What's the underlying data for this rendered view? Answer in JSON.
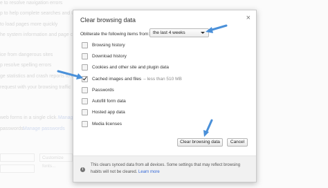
{
  "background": {
    "lines": [
      {
        "text": "e to resolve navigation errors",
        "link": false
      },
      {
        "text": "p to help complete searches and URLs",
        "link": false
      },
      {
        "text": "to load pages more quickly",
        "link": false
      },
      {
        "text": "he system information and page content",
        "link": false
      },
      {
        "text": "ice from dangerous sites",
        "link": false
      },
      {
        "text": "p resolve spelling errors",
        "link": false
      },
      {
        "text": "ge statistics and crash reports to Google",
        "link": false
      },
      {
        "text": "request with your browsing traffic",
        "link": false
      },
      {
        "text": "web forms in a single click.",
        "link": false
      },
      {
        "text": "Manage",
        "link": true
      },
      {
        "text": "passwords.",
        "link": false
      },
      {
        "text": "Manage passwords",
        "link": true
      }
    ],
    "fields": [
      "Customize fonts..."
    ]
  },
  "dialog": {
    "title": "Clear browsing data",
    "close_glyph": "×",
    "obliterate_label": "Obliterate the following items from:",
    "time_range": "the last 4 weeks",
    "options": [
      {
        "label": "Browsing history",
        "checked": false,
        "note": ""
      },
      {
        "label": "Download history",
        "checked": false,
        "note": ""
      },
      {
        "label": "Cookies and other site and plugin data",
        "checked": false,
        "note": ""
      },
      {
        "label": "Cached images and files",
        "checked": true,
        "note": "– less than 510 MB"
      },
      {
        "label": "Passwords",
        "checked": false,
        "note": ""
      },
      {
        "label": "Autofill form data",
        "checked": false,
        "note": ""
      },
      {
        "label": "Hosted app data",
        "checked": false,
        "note": ""
      },
      {
        "label": "Media licenses",
        "checked": false,
        "note": ""
      }
    ],
    "clear_button": "Clear browsing data",
    "cancel_button": "Cancel",
    "footer_text": "This clears synced data from all devices. Some settings that may reflect browsing habits will not be cleared.",
    "footer_link": "Learn more",
    "info_glyph": "i"
  },
  "colors": {
    "arrow": "#4a90d9",
    "link": "#3367d6"
  }
}
